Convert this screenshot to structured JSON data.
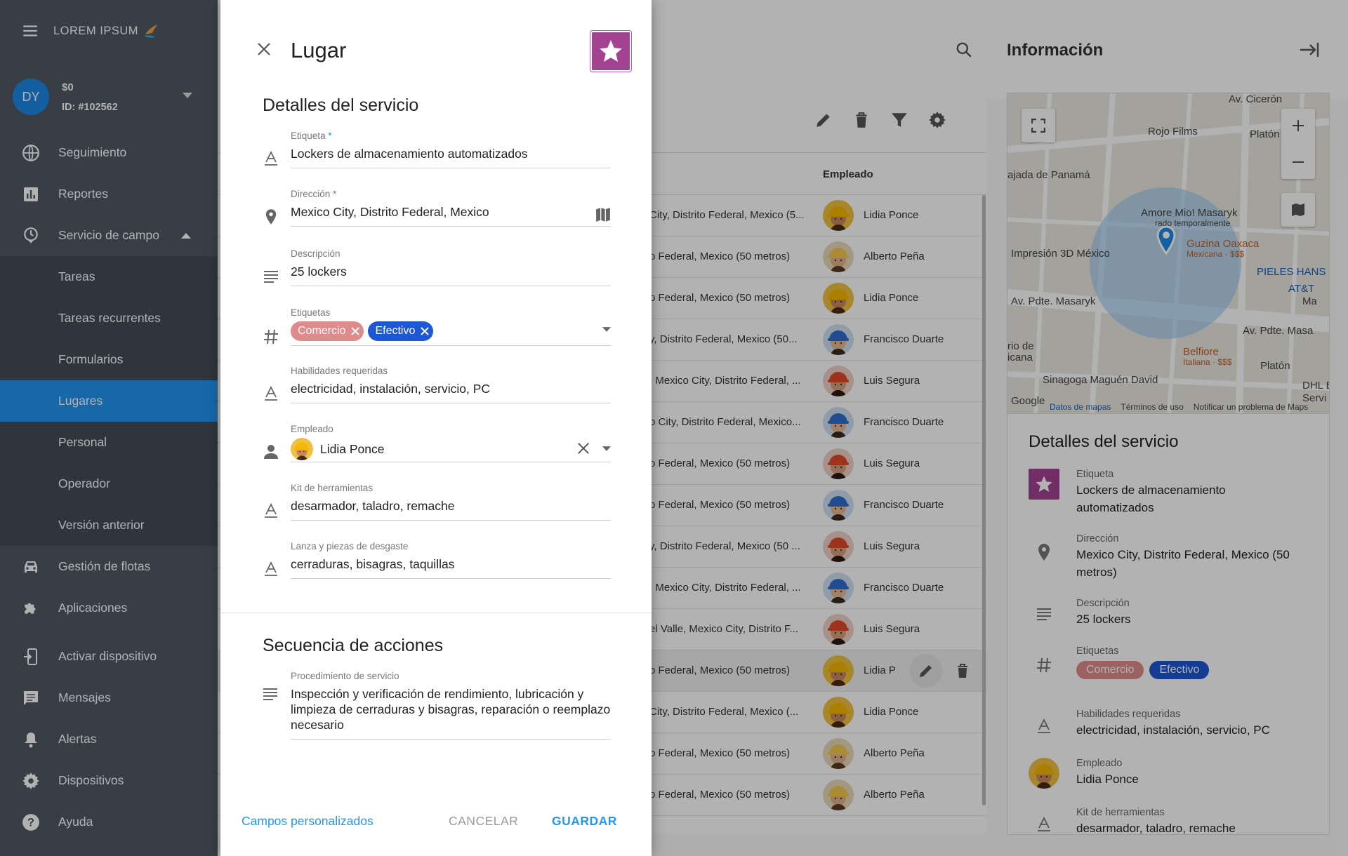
{
  "sidebar": {
    "logo": "LOREM IPSUM",
    "user": {
      "initials": "DY",
      "balance": "$0",
      "id": "ID: #102562"
    },
    "items": [
      {
        "label": "Seguimiento",
        "icon": "globe-icon"
      },
      {
        "label": "Reportes",
        "icon": "bar-chart-icon"
      },
      {
        "label": "Servicio de campo",
        "icon": "clock-icon",
        "expanded": true
      },
      {
        "label": "Tareas"
      },
      {
        "label": "Tareas recurrentes"
      },
      {
        "label": "Formularios"
      },
      {
        "label": "Lugares",
        "active": true
      },
      {
        "label": "Personal"
      },
      {
        "label": "Operador"
      },
      {
        "label": "Versión anterior"
      },
      {
        "label": "Gestión de flotas",
        "icon": "car-icon"
      },
      {
        "label": "Aplicaciones",
        "icon": "puzzle-icon"
      },
      {
        "label": "Activar dispositivo",
        "icon": "device-login-icon"
      },
      {
        "label": "Mensajes",
        "icon": "chat-icon"
      },
      {
        "label": "Alertas",
        "icon": "bell-icon"
      },
      {
        "label": "Dispositivos",
        "icon": "gear-icon"
      },
      {
        "label": "Ayuda",
        "icon": "help-icon"
      }
    ]
  },
  "table": {
    "employee_header": "Empleado",
    "rows": [
      {
        "address": "City, Distrito Federal, Mexico (5...",
        "employee": "Lidia Ponce",
        "avatar": "lidia"
      },
      {
        "address": "o Federal, Mexico (50 metros)",
        "employee": "Alberto Peña",
        "avatar": "alberto"
      },
      {
        "address": "o Federal, Mexico (50 metros)",
        "employee": "Lidia Ponce",
        "avatar": "lidia"
      },
      {
        "address": "y, Distrito Federal, Mexico (50...",
        "employee": "Francisco Duarte",
        "avatar": "francisco"
      },
      {
        "address": ", Mexico City, Distrito Federal, ...",
        "employee": "Luis Segura",
        "avatar": "luis"
      },
      {
        "address": "o City, Distrito Federal, Mexico...",
        "employee": "Francisco Duarte",
        "avatar": "francisco"
      },
      {
        "address": "o Federal, Mexico (50 metros)",
        "employee": "Luis Segura",
        "avatar": "luis"
      },
      {
        "address": "o Federal, Mexico (50 metros)",
        "employee": "Francisco Duarte",
        "avatar": "francisco"
      },
      {
        "address": "y, Distrito Federal, Mexico (50 ...",
        "employee": "Luis Segura",
        "avatar": "luis"
      },
      {
        "address": ", Mexico City, Distrito Federal, ...",
        "employee": "Francisco Duarte",
        "avatar": "francisco"
      },
      {
        "address": "el Valle, Mexico City, Distrito F...",
        "employee": "Luis Segura",
        "avatar": "luis"
      },
      {
        "address": "o Federal, Mexico (50 metros)",
        "employee": "Lidia P",
        "avatar": "lidia",
        "highlighted": true
      },
      {
        "address": "City, Distrito Federal, Mexico (...",
        "employee": "Lidia Ponce",
        "avatar": "lidia"
      },
      {
        "address": "o Federal, Mexico (50 metros)",
        "employee": "Alberto Peña",
        "avatar": "alberto"
      },
      {
        "address": "o Federal, Mexico (50 metros)",
        "employee": "Alberto Peña",
        "avatar": "alberto"
      }
    ]
  },
  "info": {
    "title": "Información",
    "map": {
      "labels": [
        "Av. Cicerón",
        "Rojo Films",
        "Platón",
        "ajada de Panamá",
        "Amore Mio! Masaryk",
        "rado temporalmente",
        "Guzina Oaxaca",
        "Mexicana · $$$",
        "Impresión 3D México",
        "PIELES HANS",
        "AT&T",
        "Ma",
        "Av. Pdte. Masaryk",
        "Av. Pdte. Masa",
        "rio de",
        "icana",
        "Belfiore",
        "Italiana · $$$",
        "Sinagoga Maguén David",
        "Platón",
        "DHL E",
        "Servi",
        "Google"
      ],
      "footer": [
        "Datos de mapas",
        "Términos de uso",
        "Notificar un problema de Maps"
      ]
    },
    "card_title": "Detalles del servicio",
    "fields": [
      {
        "label": "Etiqueta",
        "value": "Lockers de almacenamiento automatizados"
      },
      {
        "label": "Dirección",
        "value": "Mexico City, Distrito Federal, Mexico (50 metros)"
      },
      {
        "label": "Descripción",
        "value": "25 lockers"
      },
      {
        "label": "Etiquetas"
      },
      {
        "label": "Habilidades requeridas",
        "value": "electricidad, instalación, servicio, PC"
      },
      {
        "label": "Empleado",
        "value": "Lidia Ponce"
      },
      {
        "label": "Kit de herramientas",
        "value": "desarmador, taladro, remache"
      }
    ],
    "tags": [
      "Comercio",
      "Efectivo"
    ]
  },
  "dialog": {
    "title": "Lugar",
    "section1": "Detalles del servicio",
    "label_field": {
      "label": "Etiqueta",
      "required": "*",
      "value": "Lockers de almacenamiento automatizados"
    },
    "address_field": {
      "label": "Dirección",
      "required": "*",
      "value": "Mexico City, Distrito Federal, Mexico"
    },
    "description_field": {
      "label": "Descripción",
      "value": "25 lockers"
    },
    "tags_field": {
      "label": "Etiquetas",
      "tags": [
        "Comercio",
        "Efectivo"
      ]
    },
    "skills_field": {
      "label": "Habilidades requeridas",
      "value": "electricidad, instalación, servicio, PC"
    },
    "employee_field": {
      "label": "Empleado",
      "value": "Lidia Ponce"
    },
    "toolkit_field": {
      "label": "Kit de herramientas",
      "value": "desarmador, taladro, remache"
    },
    "parts_field": {
      "label": "Lanza y piezas de desgaste",
      "value": "cerraduras, bisagras, taquillas"
    },
    "section2": "Secuencia de acciones",
    "procedure_field": {
      "label": "Procedimiento de servicio",
      "value": "Inspección y verificación de rendimiento, lubricación y limpieza de cerraduras y bisagras, reparación o reemplazo necesario"
    },
    "footer": {
      "custom_fields": "Campos personalizados",
      "cancel": "CANCELAR",
      "save": "GUARDAR"
    }
  },
  "colors": {
    "sidebar_bg": "#4f5964",
    "active_item": "#2196f3",
    "tag_comercio": "#e08b8b",
    "tag_efectivo": "#1e57d6",
    "favorite_bg": "#a24291",
    "primary": "#2196f3"
  }
}
